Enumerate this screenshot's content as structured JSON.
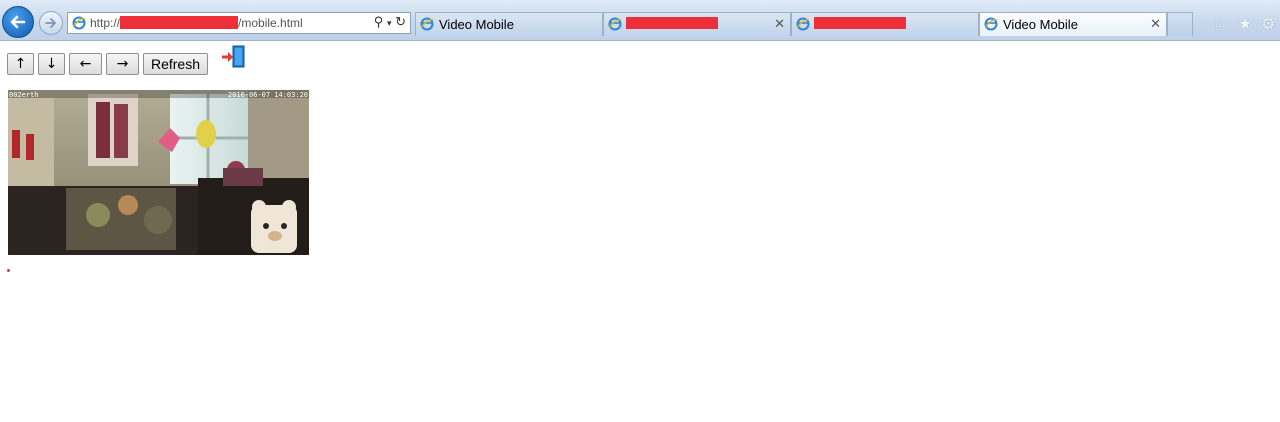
{
  "browser": {
    "address": {
      "prefix": "http://",
      "suffix": "/mobile.html"
    },
    "tabs": [
      {
        "title": "Video Mobile",
        "active": false,
        "redacted": false
      },
      {
        "title": "",
        "active": false,
        "redacted": true
      },
      {
        "title": "",
        "active": false,
        "redacted": true
      },
      {
        "title": "Video Mobile",
        "active": true,
        "redacted": false
      }
    ]
  },
  "page": {
    "controls": {
      "up": "↑",
      "down": "↓",
      "left": "←",
      "right": "→",
      "refresh": "Refresh"
    },
    "camera": {
      "osd_left": "002erth",
      "osd_right": "2016-06-07 14:03:20"
    }
  },
  "colors": {
    "redaction": "#ee2f3a",
    "accent": "#1f6fc4"
  }
}
